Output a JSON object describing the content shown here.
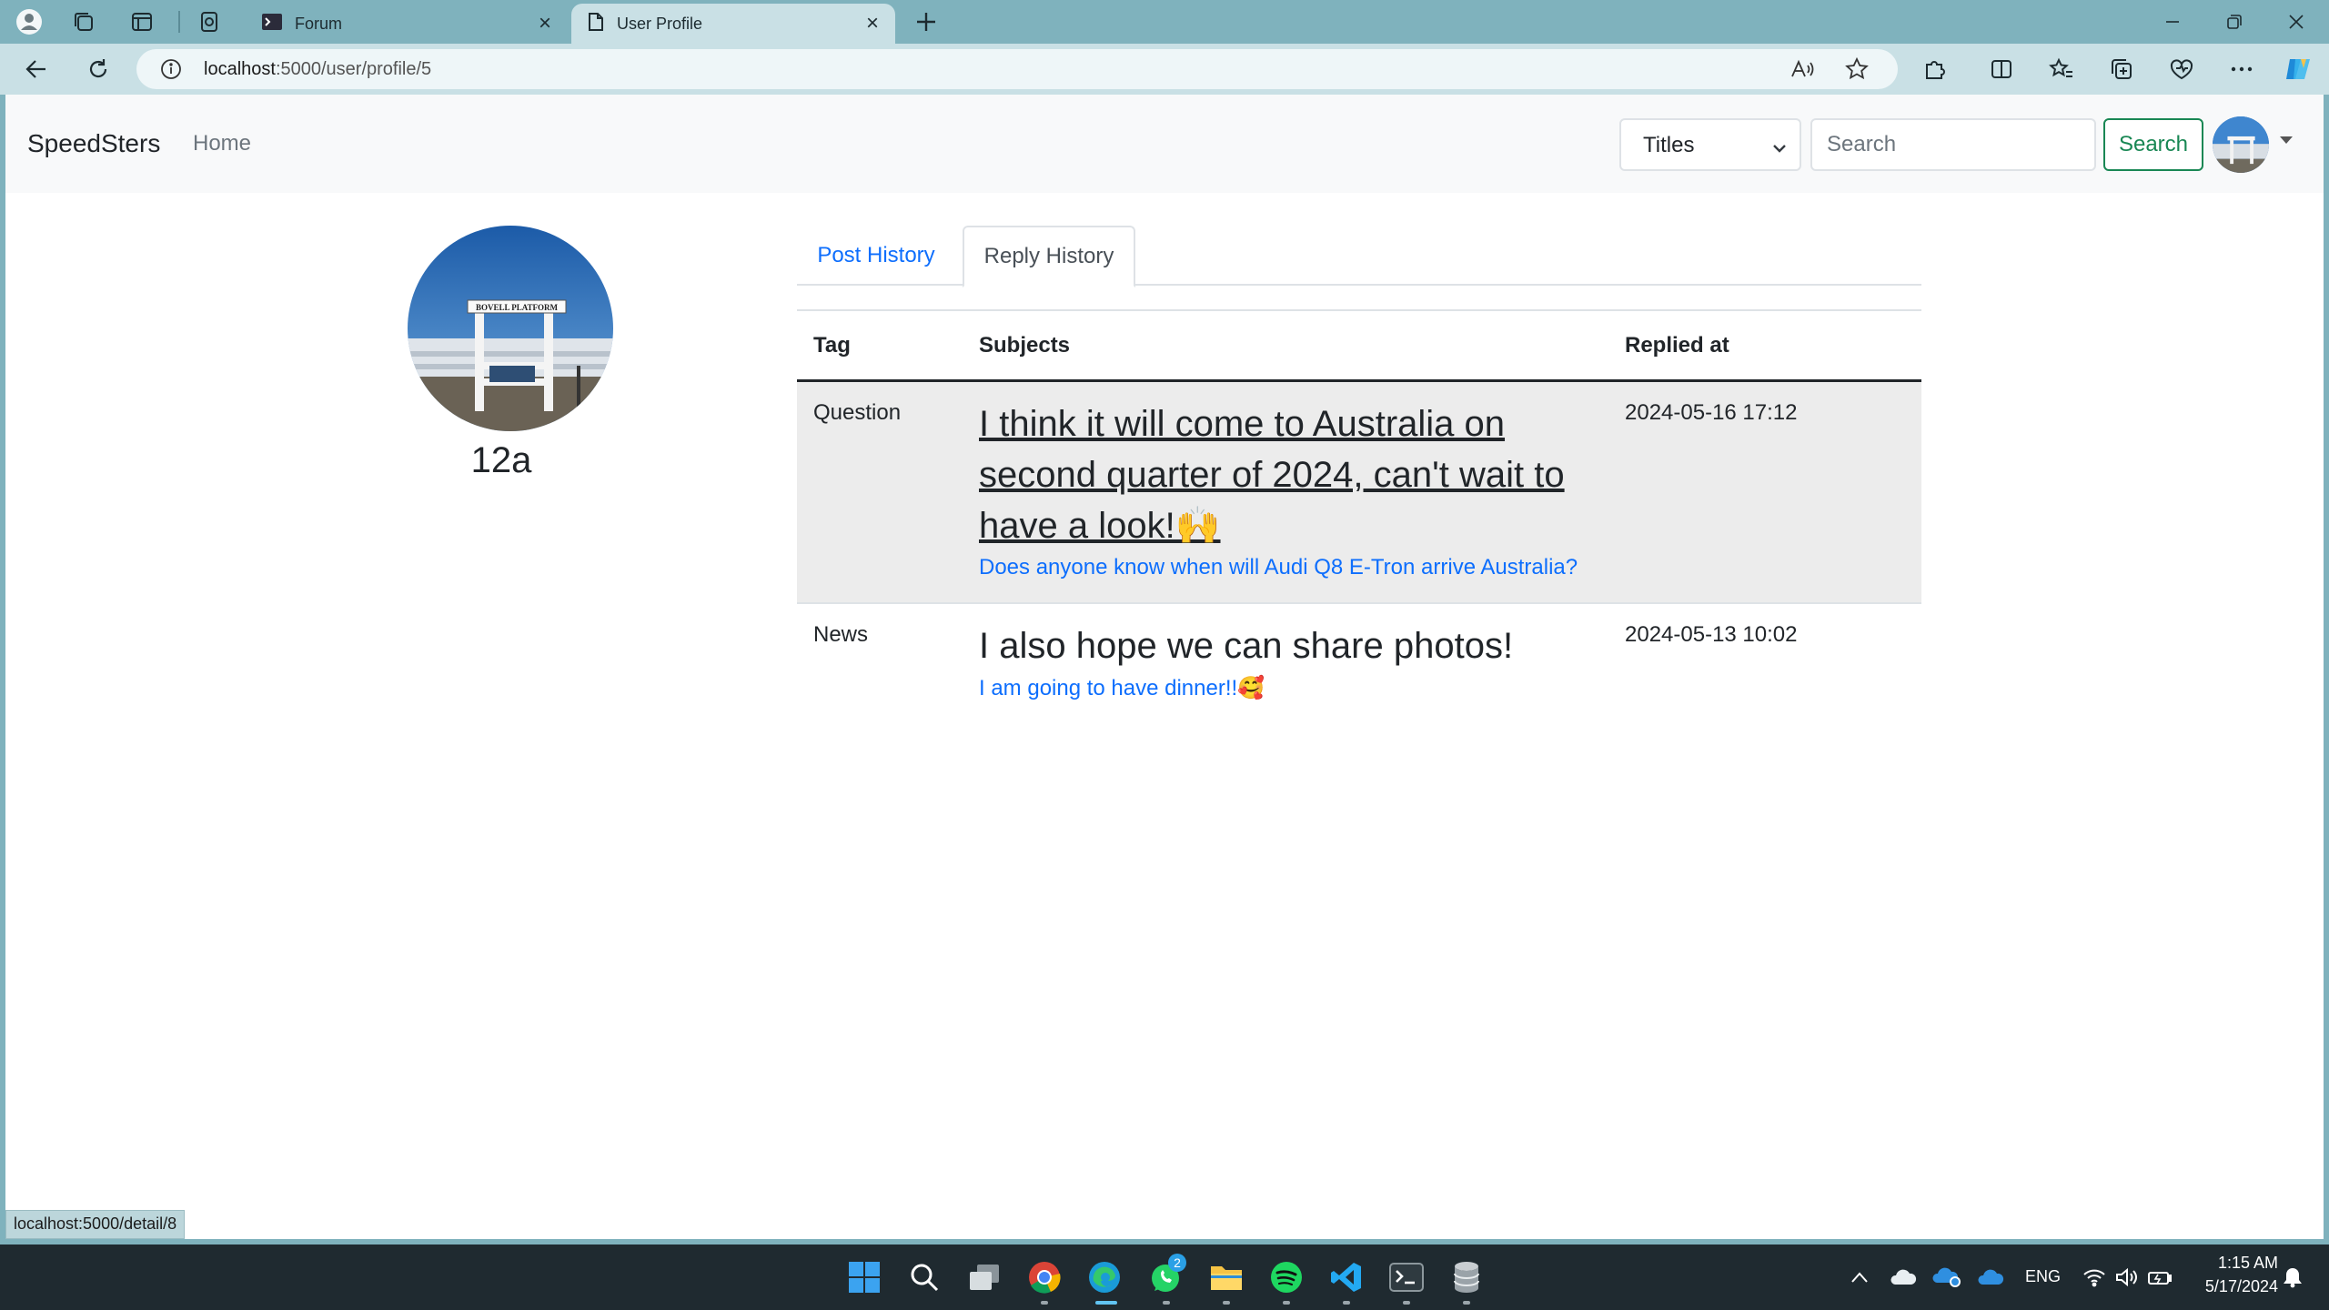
{
  "browser": {
    "tabs": [
      {
        "title": "Forum"
      },
      {
        "title": "User Profile"
      }
    ],
    "url_host": "localhost",
    "url_path": ":5000/user/profile/5",
    "status_link": "localhost:5000/detail/8"
  },
  "navbar": {
    "brand": "SpeedSters",
    "home": "Home",
    "search_scope": "Titles",
    "search_placeholder": "Search",
    "search_button": "Search"
  },
  "profile": {
    "username": "12a",
    "avatar_sign_text": "BOVELL PLATFORM"
  },
  "profile_tabs": {
    "post_history": "Post History",
    "reply_history": "Reply History",
    "active": "Reply History"
  },
  "table": {
    "headers": {
      "tag": "Tag",
      "subjects": "Subjects",
      "replied_at": "Replied at"
    },
    "rows": [
      {
        "tag": "Question",
        "content": "I think it will come to Australia on second quarter of 2024, can't wait to have a look!🙌",
        "post_title": "Does anyone know when will Audi Q8 E-Tron arrive Australia?",
        "replied_at": "2024-05-16 17:12"
      },
      {
        "tag": "News",
        "content": "I also hope we can share photos!",
        "post_title": "I am going to have dinner!!🥰",
        "replied_at": "2024-05-13 10:02"
      }
    ]
  },
  "taskbar": {
    "whatsapp_badge": "2",
    "language": "ENG",
    "time": "1:15 AM",
    "date": "5/17/2024"
  },
  "colors": {
    "link_blue": "#0d6efd",
    "success_green": "#198754",
    "browser_frame": "#7fb2bd",
    "toolbar": "#c9e0e5",
    "taskbar": "#1f2a30"
  }
}
